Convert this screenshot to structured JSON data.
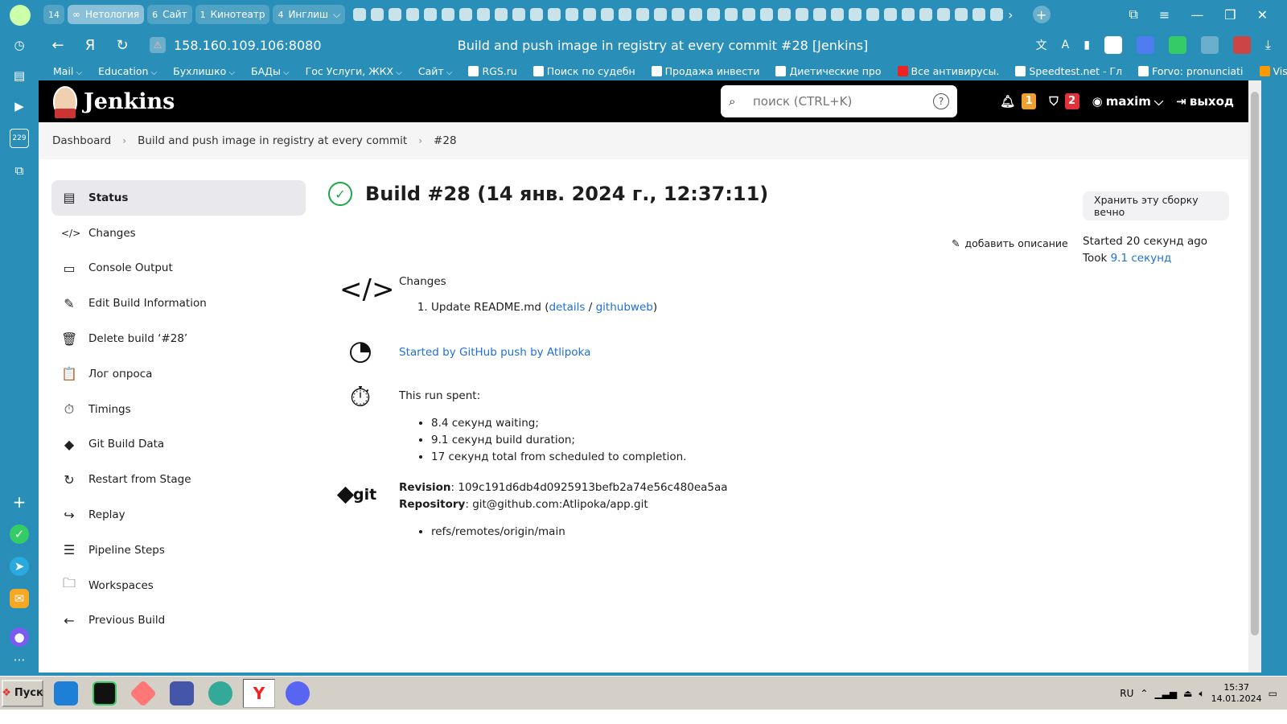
{
  "browser": {
    "tabs": [
      {
        "num": "14",
        "label": ""
      },
      {
        "num": "",
        "label": "Нетология"
      },
      {
        "num": "6",
        "label": "Сайт"
      },
      {
        "num": "1",
        "label": "Кинотеатр"
      },
      {
        "num": "4",
        "label": "Инглиш"
      }
    ],
    "url": "158.160.109.106:8080",
    "page_title": "Build and push image in registry at every commit #28 [Jenkins]",
    "bookmarks": [
      {
        "label": "Mail",
        "dropdown": true
      },
      {
        "label": "Education",
        "dropdown": true
      },
      {
        "label": "Бухлишко",
        "dropdown": true
      },
      {
        "label": "БАДы",
        "dropdown": true
      },
      {
        "label": "Гос Услуги, ЖКХ",
        "dropdown": true
      },
      {
        "label": "Сайт",
        "dropdown": true
      },
      {
        "label": "RGS.ru",
        "dropdown": false
      },
      {
        "label": "Поиск по судебн",
        "dropdown": false
      },
      {
        "label": "Продажа инвести",
        "dropdown": false
      },
      {
        "label": "Диетические про",
        "dropdown": false
      },
      {
        "label": "Все антивирусы.",
        "dropdown": false
      },
      {
        "label": "Speedtest.net - Гл",
        "dropdown": false
      },
      {
        "label": "Forvo: pronunciati",
        "dropdown": false
      },
      {
        "label": "Vis",
        "dropdown": false
      }
    ],
    "sidebar_badge": "229"
  },
  "jenkins": {
    "title": "Jenkins",
    "search_placeholder": "поиск (CTRL+K)",
    "notifications_count": "1",
    "security_count": "2",
    "user": "maxim",
    "logout": "выход"
  },
  "breadcrumb": [
    "Dashboard",
    "Build and push image in registry at every commit",
    "#28"
  ],
  "sidenav": [
    {
      "label": "Status",
      "icon": "status-icon",
      "glyph": "▤",
      "active": true
    },
    {
      "label": "Changes",
      "icon": "code-icon",
      "glyph": "</>",
      "active": false
    },
    {
      "label": "Console Output",
      "icon": "terminal-icon",
      "glyph": "▭",
      "active": false
    },
    {
      "label": "Edit Build Information",
      "icon": "edit-icon",
      "glyph": "✎",
      "active": false
    },
    {
      "label": "Delete build ‘#28’",
      "icon": "trash-icon",
      "glyph": "🗑",
      "active": false
    },
    {
      "label": "Лог опроса",
      "icon": "clipboard-icon",
      "glyph": "📋",
      "active": false
    },
    {
      "label": "Timings",
      "icon": "stopwatch-icon",
      "glyph": "⏱",
      "active": false
    },
    {
      "label": "Git Build Data",
      "icon": "git-icon",
      "glyph": "◆",
      "active": false
    },
    {
      "label": "Restart from Stage",
      "icon": "restart-icon",
      "glyph": "↻",
      "active": false
    },
    {
      "label": "Replay",
      "icon": "replay-icon",
      "glyph": "↪",
      "active": false
    },
    {
      "label": "Pipeline Steps",
      "icon": "list-icon",
      "glyph": "☰",
      "active": false
    },
    {
      "label": "Workspaces",
      "icon": "folder-icon",
      "glyph": "🗀",
      "active": false
    },
    {
      "label": "Previous Build",
      "icon": "arrow-left-icon",
      "glyph": "←",
      "active": false
    }
  ],
  "build": {
    "title": "Build #28 (14 янв. 2024 г., 12:37:11)",
    "keep_button": "Хранить эту сборку вечно",
    "add_description": "добавить описание",
    "started_label": "Started 20 секунд ago",
    "took_label": "Took",
    "took_value": "9.1 секунд",
    "changes_heading": "Changes",
    "change_item": "Update README.md",
    "change_details": "details",
    "change_web": "githubweb",
    "started_by": "Started by GitHub push by Atlipoka",
    "run_spent": "This run spent:",
    "spent_items": [
      "8.4 секунд waiting;",
      "9.1 секунд build duration;",
      "17 секунд total from scheduled to completion."
    ],
    "revision_label": "Revision",
    "revision_value": "109c191d6db4d0925913befb2a74e56c480ea5aa",
    "repository_label": "Repository",
    "repository_value": "git@github.com:Atlipoka/app.git",
    "refs": [
      "refs/remotes/origin/main"
    ],
    "git_word": "git"
  },
  "taskbar": {
    "start": "Пуск",
    "lang": "RU",
    "time": "15:37",
    "date": "14.01.2024"
  }
}
